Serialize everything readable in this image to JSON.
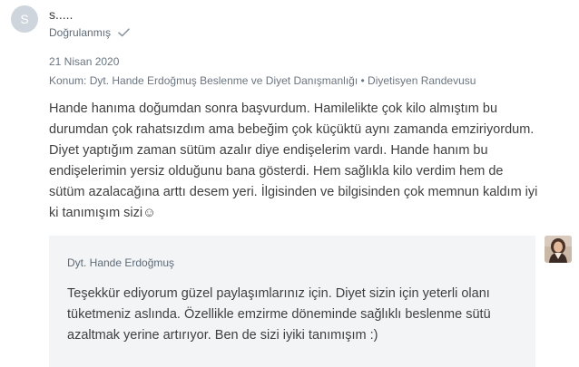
{
  "review": {
    "avatar_initial": "S",
    "reviewer_name": "s.....",
    "verified_label": "Doğrulanmış",
    "date": "21 Nisan 2020",
    "location": "Konum: Dyt. Hande Erdoğmuş Beslenme ve Diyet Danışmanlığı • Diyetisyen Randevusu",
    "text": "Hande hanıma doğumdan sonra başvurdum. Hamilelikte çok kilo almıştım bu durumdan çok rahatsızdım ama bebeğim çok küçüktü aynı zamanda emziriyordum. Diyet yaptığım zaman sütüm azalır diye endişelerim vardı. Hande hanım bu endişelerimin yersiz olduğunu bana gösterdi. Hem sağlıkla kilo verdim hem de sütüm azalacağına arttı desem yeri. İlgisinden ve bilgisinden çok memnun kaldım iyi ki tanımışım sizi☺"
  },
  "reply": {
    "author": "Dyt. Hande Erdoğmuş",
    "text": "Teşekkür ediyorum güzel paylaşımlarınız için. Diyet sizin için yeterli olanı tüketmeniz aslında. Özellikle emzirme döneminde sağlıklı beslenme sütü azaltmak yerine artırıyor. Ben de sizi iyiki tanımışım :)"
  },
  "colors": {
    "avatar_bg": "#cfd5dc",
    "reply_bg": "#f3f4f6",
    "muted_text": "#6b7580",
    "body_text": "#3f3f3f"
  },
  "icons": {
    "verified": "check-icon",
    "doctor_photo": "doctor-avatar"
  }
}
